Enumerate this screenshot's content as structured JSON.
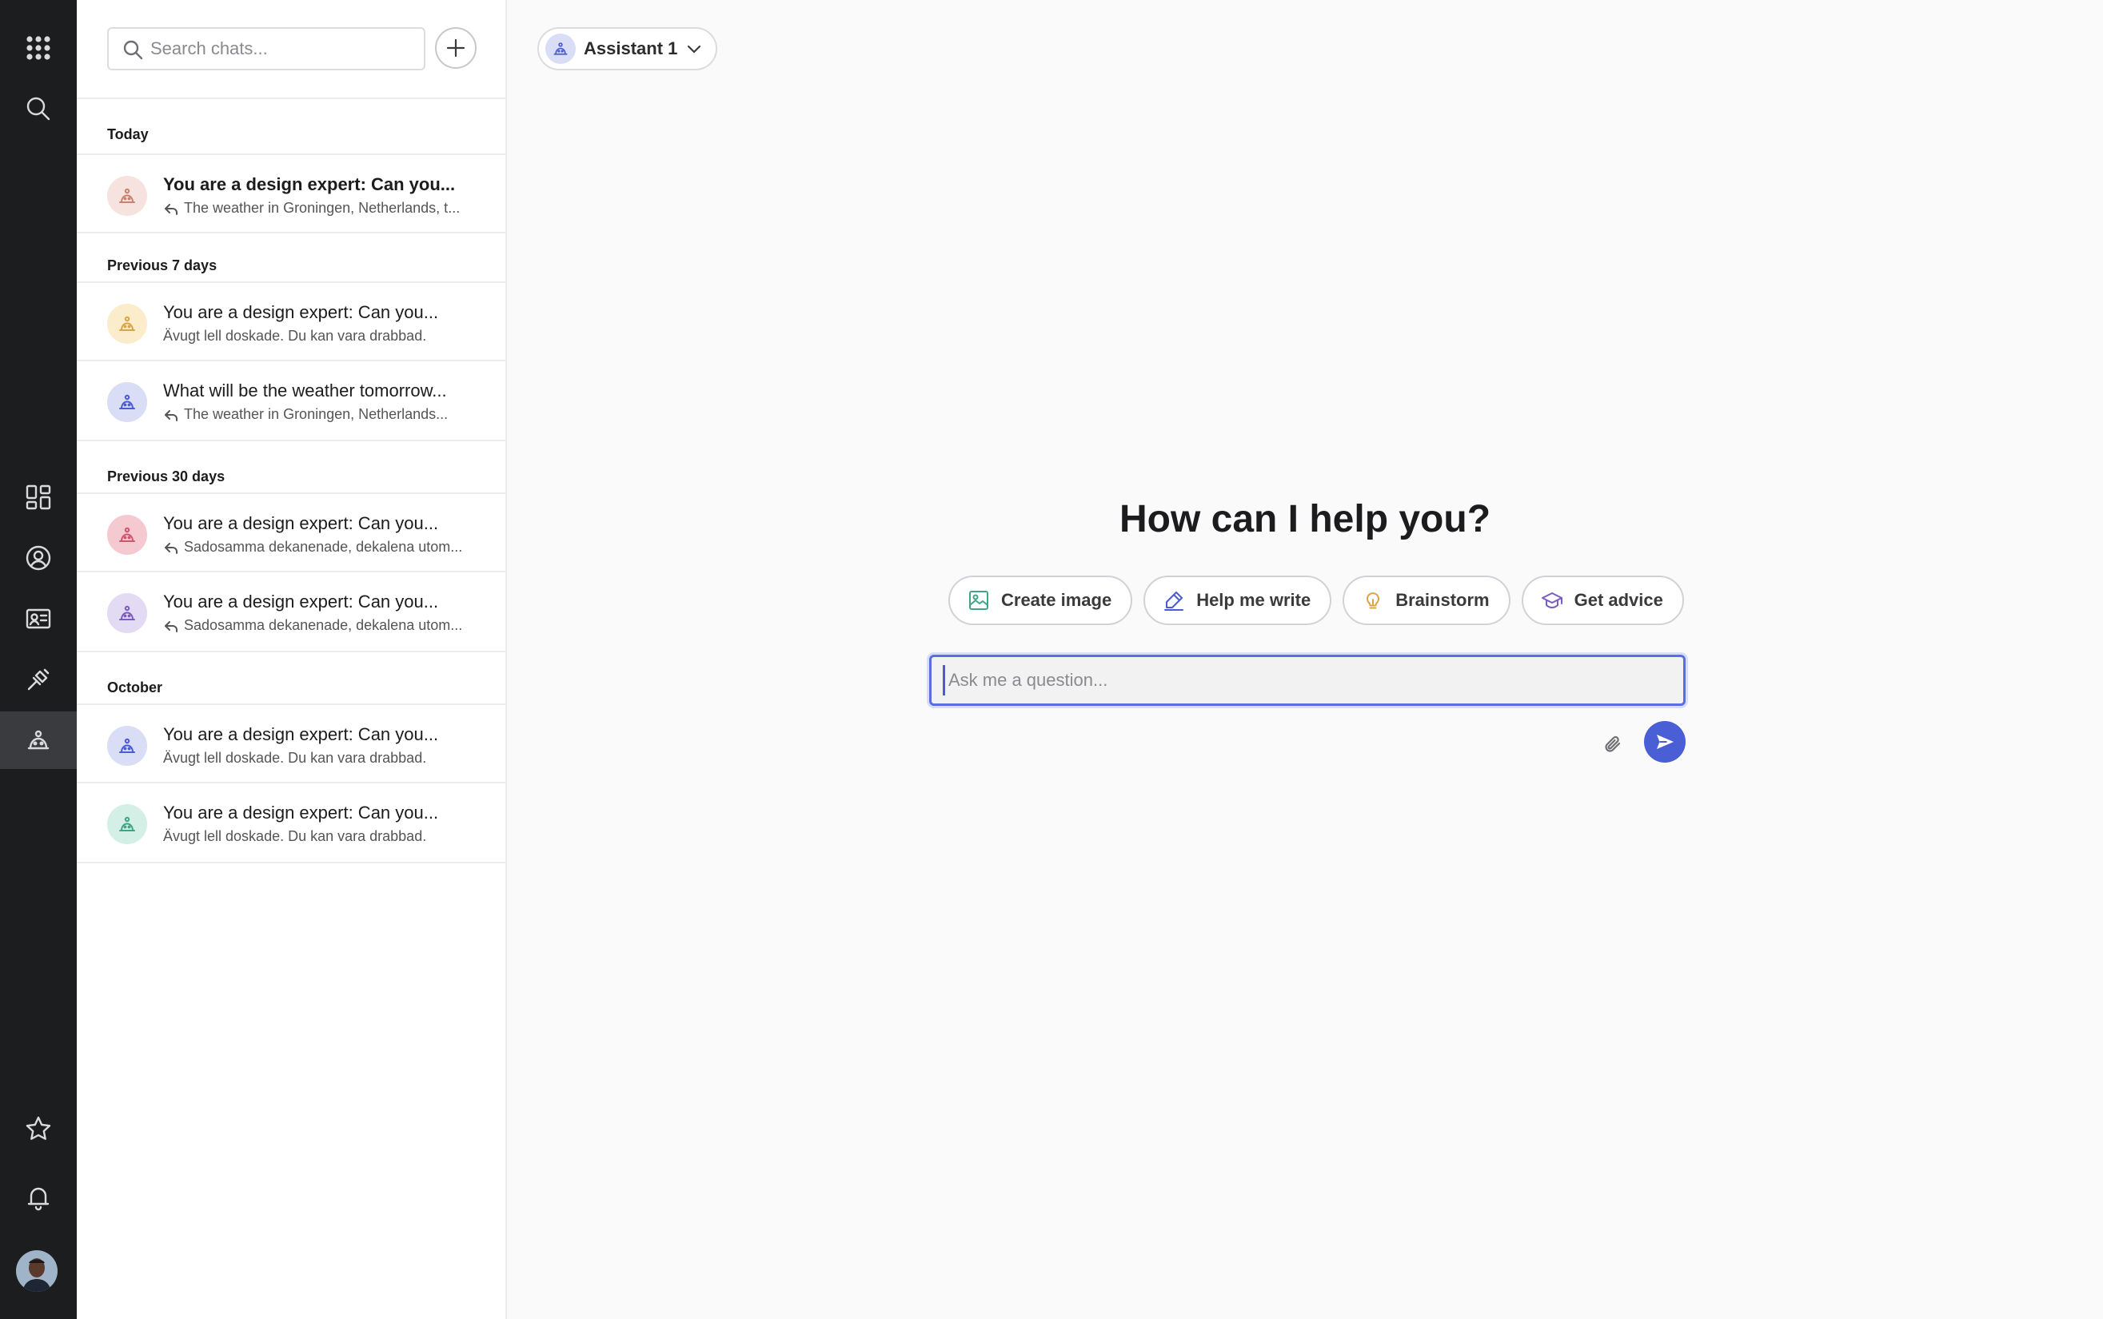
{
  "rail": {
    "top_items": [
      {
        "name": "apps-grid-icon"
      },
      {
        "name": "search-icon"
      }
    ],
    "mid_items": [
      {
        "name": "dashboard-icon"
      },
      {
        "name": "profile-icon"
      },
      {
        "name": "contact-card-icon"
      },
      {
        "name": "integrations-icon"
      },
      {
        "name": "assistant-icon",
        "active": true
      }
    ],
    "bottom_items": [
      {
        "name": "star-icon"
      },
      {
        "name": "bell-icon"
      }
    ]
  },
  "chat_panel": {
    "search_placeholder": "Search chats...",
    "groups": [
      {
        "label": "Today",
        "items": [
          {
            "title": "You are a design expert: Can you...",
            "subtitle": "The weather in Groningen, Netherlands, t...",
            "reply_icon": true,
            "bold": true,
            "avatar_bg": "#f6e3df",
            "avatar_color": "#c9826f"
          }
        ]
      },
      {
        "label": "Previous 7 days",
        "items": [
          {
            "title": "You are a design expert: Can you...",
            "subtitle": "Ävugt lell doskade. Du kan vara drabbad.",
            "reply_icon": false,
            "bold": false,
            "avatar_bg": "#fbeccc",
            "avatar_color": "#d9a54a"
          },
          {
            "title": "What will be the weather tomorrow...",
            "subtitle": "The weather in Groningen, Netherlands...",
            "reply_icon": true,
            "bold": false,
            "avatar_bg": "#d9ddf5",
            "avatar_color": "#4a5bd4"
          }
        ]
      },
      {
        "label": "Previous 30 days",
        "items": [
          {
            "title": "You are a design expert: Can you...",
            "subtitle": "Sadosamma dekanenade, dekalena utom...",
            "reply_icon": true,
            "bold": false,
            "avatar_bg": "#f5c9d0",
            "avatar_color": "#d0566d"
          },
          {
            "title": "You are a design expert: Can you...",
            "subtitle": "Sadosamma dekanenade, dekalena utom...",
            "reply_icon": true,
            "bold": false,
            "avatar_bg": "#e3dbf3",
            "avatar_color": "#7a5cc2"
          }
        ]
      },
      {
        "label": "October",
        "items": [
          {
            "title": "You are a design expert: Can you...",
            "subtitle": "Ävugt lell doskade. Du kan vara drabbad.",
            "reply_icon": false,
            "bold": false,
            "avatar_bg": "#d9ddf5",
            "avatar_color": "#4a5bd4"
          },
          {
            "title": "You are a design expert: Can you...",
            "subtitle": "Ävugt lell doskade. Du kan vara drabbad.",
            "reply_icon": false,
            "bold": false,
            "avatar_bg": "#d3efe6",
            "avatar_color": "#3fa586"
          }
        ]
      }
    ]
  },
  "main": {
    "assistant_selector": "Assistant 1",
    "heading": "How can I help you?",
    "suggestions": [
      {
        "label": "Create image",
        "icon": "image-icon",
        "color": "#3fa586"
      },
      {
        "label": "Help me write",
        "icon": "pen-icon",
        "color": "#4a5bd4"
      },
      {
        "label": "Brainstorm",
        "icon": "lightbulb-icon",
        "color": "#d9a54a"
      },
      {
        "label": "Get advice",
        "icon": "graduation-cap-icon",
        "color": "#7a5cc2"
      }
    ],
    "input_placeholder": "Ask me a question...",
    "accent": "#4a5fd6"
  }
}
